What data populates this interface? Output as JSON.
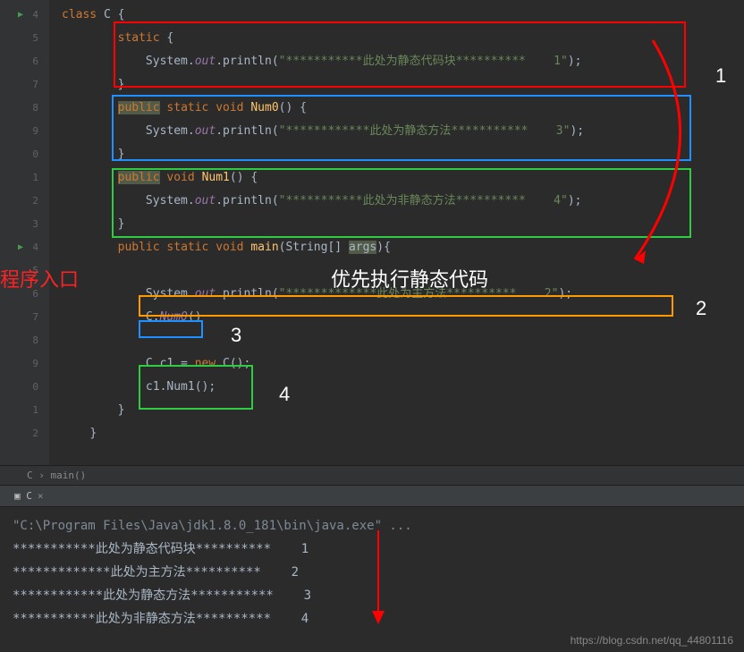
{
  "lineNumbers": [
    "4",
    "5",
    "6",
    "7",
    "8",
    "9",
    "0",
    "1",
    "2",
    "3",
    "4",
    "5",
    "6",
    "7",
    "8",
    "9",
    "0",
    "1",
    "2"
  ],
  "code": {
    "l1": "class C {",
    "l2a": "static",
    "l2b": " {",
    "l3a": "System.",
    "l3b": "out",
    "l3c": ".println(",
    "l3d": "\"***********此处为静态代码块**********    1\"",
    "l3e": ");",
    "l4": "}",
    "l5a": "public",
    "l5b": " static void ",
    "l5c": "Num0",
    "l5d": "() {",
    "l6a": "System.",
    "l6b": "out",
    "l6c": ".println(",
    "l6d": "\"************此处为静态方法***********    3\"",
    "l6e": ");",
    "l7": "}",
    "l8a": "public",
    "l8b": " void ",
    "l8c": "Num1",
    "l8d": "() {",
    "l9a": "System.",
    "l9b": "out",
    "l9c": ".println(",
    "l9d": "\"***********此处为非静态方法**********    4\"",
    "l9e": ");",
    "l10": "}",
    "l11a": "public static void ",
    "l11b": "main",
    "l11c": "(String[] ",
    "l11d": "args",
    "l11e": "){",
    "l13a": "System.",
    "l13b": "out",
    "l13c": ".println(",
    "l13d": "\"*************此处为主方法**********    2\"",
    "l13e": ");",
    "l14a": "C.",
    "l14b": "Num0",
    "l14c": "()",
    "l16a": "C c1 = ",
    "l16b": "new",
    "l16c": " C();",
    "l17a": "c1.Num1();",
    "l18": "}",
    "l19": "}"
  },
  "annotations": {
    "entry": "程序入口",
    "priority": "优先执行静态代码",
    "n1": "1",
    "n2": "2",
    "n3": "3",
    "n4": "4"
  },
  "breadcrumb": {
    "cls": "C",
    "mth": "main()"
  },
  "tab": "C",
  "console": {
    "l1": "\"C:\\Program Files\\Java\\jdk1.8.0_181\\bin\\java.exe\" ...",
    "l2": "***********此处为静态代码块**********    1",
    "l3": "*************此处为主方法**********    2",
    "l4": "************此处为静态方法***********    3",
    "l5": "***********此处为非静态方法**********    4"
  },
  "watermark": "https://blog.csdn.net/qq_44801116"
}
